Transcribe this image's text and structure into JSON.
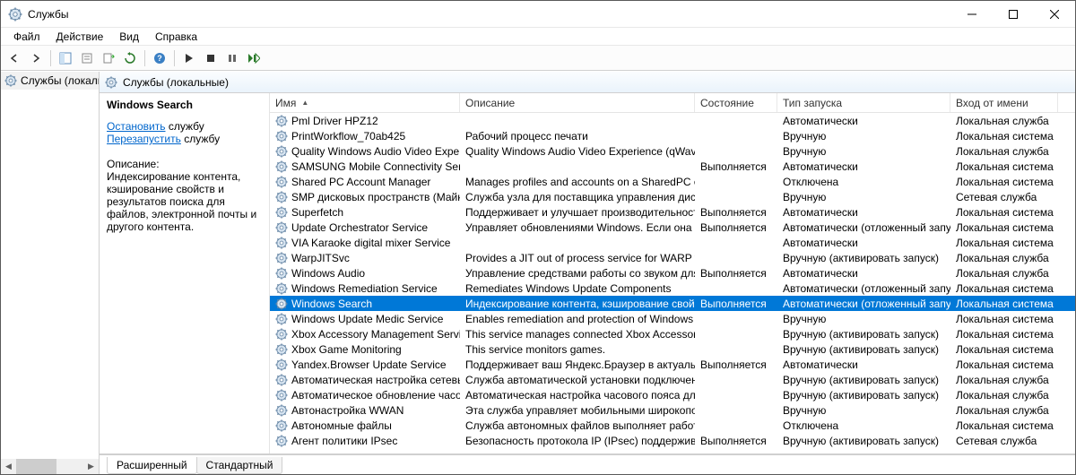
{
  "window": {
    "title": "Службы"
  },
  "menu": {
    "file": "Файл",
    "action": "Действие",
    "view": "Вид",
    "help": "Справка"
  },
  "tree": {
    "root": "Службы (локальные)"
  },
  "rightHeader": {
    "title": "Службы (локальные)"
  },
  "detail": {
    "heading": "Windows Search",
    "stop_link": "Остановить",
    "stop_suffix": " службу",
    "restart_link": "Перезапустить",
    "restart_suffix": " службу",
    "desc_label": "Описание:",
    "desc_text": "Индексирование контента, кэширование свойств и результатов поиска для файлов, электронной почты и другого контента."
  },
  "columns": {
    "name": "Имя",
    "desc": "Описание",
    "state": "Состояние",
    "start": "Тип запуска",
    "logon": "Вход от имени"
  },
  "tabs": {
    "extended": "Расширенный",
    "standard": "Стандартный"
  },
  "services": [
    {
      "name": "Pml Driver HPZ12",
      "desc": "",
      "state": "",
      "start": "Автоматически",
      "logon": "Локальная служба",
      "sel": false
    },
    {
      "name": "PrintWorkflow_70ab425",
      "desc": "Рабочий процесс печати",
      "state": "",
      "start": "Вручную",
      "logon": "Локальная система",
      "sel": false
    },
    {
      "name": "Quality Windows Audio Video Experience",
      "desc": "Quality Windows Audio Video Experience (qWave) - с...",
      "state": "",
      "start": "Вручную",
      "logon": "Локальная служба",
      "sel": false
    },
    {
      "name": "SAMSUNG Mobile Connectivity Service",
      "desc": "",
      "state": "Выполняется",
      "start": "Автоматически",
      "logon": "Локальная система",
      "sel": false
    },
    {
      "name": "Shared PC Account Manager",
      "desc": "Manages profiles and accounts on a SharedPC config...",
      "state": "",
      "start": "Отключена",
      "logon": "Локальная система",
      "sel": false
    },
    {
      "name": "SMP дисковых пространств (Майкрос...",
      "desc": "Служба узла для поставщика управления дисковы...",
      "state": "",
      "start": "Вручную",
      "logon": "Сетевая служба",
      "sel": false
    },
    {
      "name": "Superfetch",
      "desc": "Поддерживает и улучшает производительность си...",
      "state": "Выполняется",
      "start": "Автоматически",
      "logon": "Локальная система",
      "sel": false
    },
    {
      "name": "Update Orchestrator Service",
      "desc": "Управляет обновлениями Windows. Если она оста...",
      "state": "Выполняется",
      "start": "Автоматически (отложенный запуск)",
      "logon": "Локальная система",
      "sel": false
    },
    {
      "name": "VIA Karaoke digital mixer Service",
      "desc": "",
      "state": "",
      "start": "Автоматически",
      "logon": "Локальная система",
      "sel": false
    },
    {
      "name": "WarpJITSvc",
      "desc": "Provides a JIT out of process service for WARP when r...",
      "state": "",
      "start": "Вручную (активировать запуск)",
      "logon": "Локальная служба",
      "sel": false
    },
    {
      "name": "Windows Audio",
      "desc": "Управление средствами работы со звуком для про...",
      "state": "Выполняется",
      "start": "Автоматически",
      "logon": "Локальная служба",
      "sel": false
    },
    {
      "name": "Windows Remediation Service",
      "desc": "Remediates Windows Update Components",
      "state": "",
      "start": "Автоматически (отложенный запуск)",
      "logon": "Локальная система",
      "sel": false
    },
    {
      "name": "Windows Search",
      "desc": "Индексирование контента, кэширование свойств ...",
      "state": "Выполняется",
      "start": "Автоматически (отложенный запуск)",
      "logon": "Локальная система",
      "sel": true
    },
    {
      "name": "Windows Update Medic Service",
      "desc": "Enables remediation and protection of Windows Upd...",
      "state": "",
      "start": "Вручную",
      "logon": "Локальная система",
      "sel": false
    },
    {
      "name": "Xbox Accessory Management Service",
      "desc": "This service manages connected Xbox Accessories.",
      "state": "",
      "start": "Вручную (активировать запуск)",
      "logon": "Локальная система",
      "sel": false
    },
    {
      "name": "Xbox Game Monitoring",
      "desc": "This service monitors games.",
      "state": "",
      "start": "Вручную (активировать запуск)",
      "logon": "Локальная система",
      "sel": false
    },
    {
      "name": "Yandex.Browser Update Service",
      "desc": "Поддерживает ваш Яндекс.Браузер в актуальном с...",
      "state": "Выполняется",
      "start": "Автоматически",
      "logon": "Локальная система",
      "sel": false
    },
    {
      "name": "Автоматическая настройка сетевых у...",
      "desc": "Служба автоматической установки подключенны...",
      "state": "",
      "start": "Вручную (активировать запуск)",
      "logon": "Локальная служба",
      "sel": false
    },
    {
      "name": "Автоматическое обновление часовог...",
      "desc": "Автоматическая настройка часового пояса для си...",
      "state": "",
      "start": "Вручную (активировать запуск)",
      "logon": "Локальная служба",
      "sel": false
    },
    {
      "name": "Автонастройка WWAN",
      "desc": "Эта служба управляет мобильными широкополос...",
      "state": "",
      "start": "Вручную",
      "logon": "Локальная служба",
      "sel": false
    },
    {
      "name": "Автономные файлы",
      "desc": "Служба автономных файлов выполняет работу по...",
      "state": "",
      "start": "Отключена",
      "logon": "Локальная система",
      "sel": false
    },
    {
      "name": "Агент политики IPsec",
      "desc": "Безопасность протокола IP (IPsec) поддерживает п...",
      "state": "Выполняется",
      "start": "Вручную (активировать запуск)",
      "logon": "Сетевая служба",
      "sel": false
    }
  ]
}
